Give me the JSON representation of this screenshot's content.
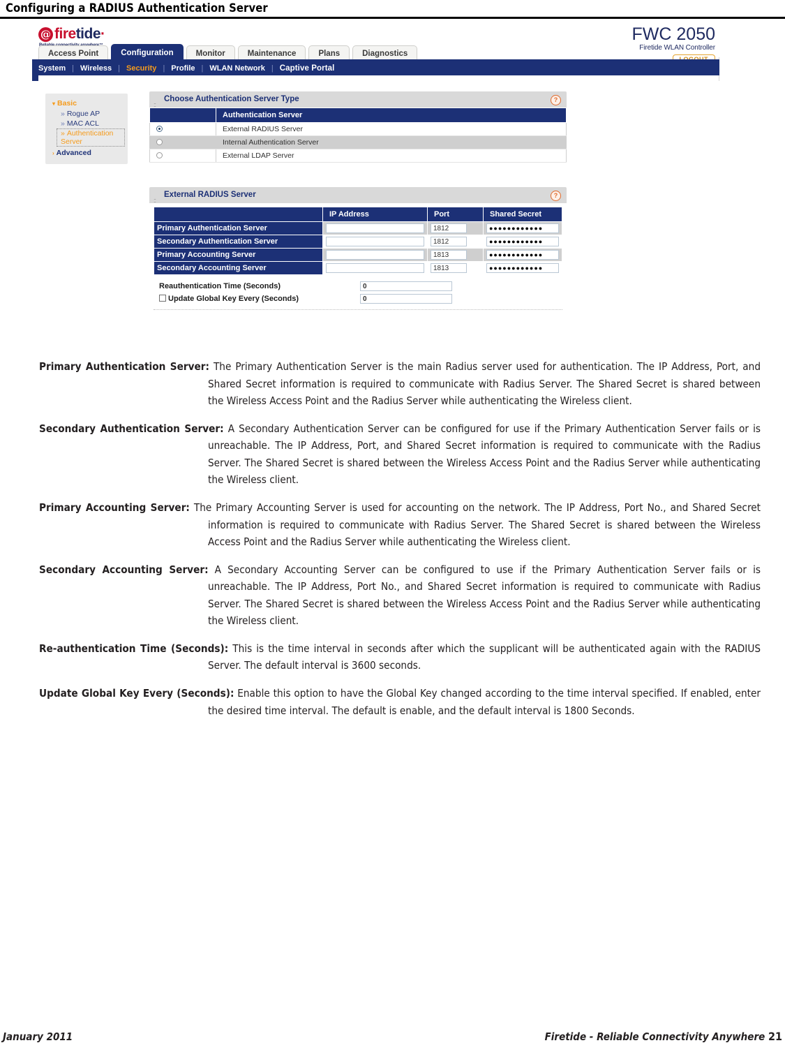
{
  "page": {
    "heading": "Configuring a RADIUS Authentication Server",
    "footer_left": "January 2011",
    "footer_right": "Firetide - Reliable Connectivity Anywhere",
    "page_number": "21"
  },
  "screenshot": {
    "brand": {
      "logo_mark": "flame-spiral-icon",
      "logo_fire": "fire",
      "logo_tide": "tide",
      "logo_dot": "·",
      "tagline": "Reliable connectivity anywhere™",
      "model_name": "FWC 2050",
      "model_sub": "Firetide WLAN Controller",
      "logout_label": "LOGOUT"
    },
    "tabs": [
      {
        "label": "Access Point",
        "active": false
      },
      {
        "label": "Configuration",
        "active": true
      },
      {
        "label": "Monitor",
        "active": false
      },
      {
        "label": "Maintenance",
        "active": false
      },
      {
        "label": "Plans",
        "active": false
      },
      {
        "label": "Diagnostics",
        "active": false
      }
    ],
    "subnav": [
      {
        "label": "System",
        "active": false
      },
      {
        "label": "Wireless",
        "active": false
      },
      {
        "label": "Security",
        "active": true
      },
      {
        "label": "Profile",
        "active": false
      },
      {
        "label": "WLAN Network",
        "active": false
      },
      {
        "label": "Captive Portal",
        "active": false
      }
    ],
    "sidebar": {
      "basic_label": "Basic",
      "basic_caret": "▾",
      "items": [
        {
          "label": "Rogue AP",
          "selected": false
        },
        {
          "label": "MAC ACL",
          "selected": false
        },
        {
          "label": "Authentication Server",
          "selected": true
        }
      ],
      "advanced_label": "Advanced",
      "advanced_caret": "›",
      "chevron": "»"
    },
    "panel_auth_type": {
      "title": "Choose Authentication Server Type",
      "help_icon_label": "?",
      "column_header": "Authentication Server",
      "options": [
        {
          "label": "External RADIUS Server",
          "selected": true
        },
        {
          "label": "Internal Authentication Server",
          "selected": false
        },
        {
          "label": "External LDAP Server",
          "selected": false
        }
      ]
    },
    "panel_radius": {
      "title": "External RADIUS Server",
      "help_icon_label": "?",
      "columns": [
        "",
        "IP Address",
        "Port",
        "Shared Secret"
      ],
      "rows": [
        {
          "label": "Primary Authentication Server",
          "ip": "",
          "port": "1812",
          "secret": "●●●●●●●●●●●●"
        },
        {
          "label": "Secondary Authentication Server",
          "ip": "",
          "port": "1812",
          "secret": "●●●●●●●●●●●●"
        },
        {
          "label": "Primary Accounting Server",
          "ip": "",
          "port": "1813",
          "secret": "●●●●●●●●●●●●"
        },
        {
          "label": "Secondary Accounting Server",
          "ip": "",
          "port": "1813",
          "secret": "●●●●●●●●●●●●"
        }
      ],
      "reauth_label": "Reauthentication Time (Seconds)",
      "reauth_value": "0",
      "globalkey_label": "Update Global Key Every (Seconds)",
      "globalkey_value": "0",
      "globalkey_checked": false
    }
  },
  "definitions": [
    {
      "term": "Primary Authentication Server:",
      "text": " The Primary Authentication Server is the main Radius server used for authentication. The IP Address, Port, and Shared Secret information is required to communicate with Radius Server. The Shared Secret is shared between the Wireless Access Point and the Radius Server while authenticating the Wireless client."
    },
    {
      "term": "Secondary Authentication Server:",
      "text": " A Secondary Authentication Server can be configured for use if the Primary Authentication Server fails or is unreachable. The IP Address, Port, and Shared Secret information is required to communicate with the Radius Server. The Shared Secret is shared between the Wireless Access Point and the Radius Server while authenticating the Wireless client."
    },
    {
      "term": "Primary Accounting Server:",
      "text": " The Primary Accounting Server is used for accounting on the network. The IP Address, Port No., and Shared Secret information is required to communicate with Radius Server. The Shared Secret is shared between the Wireless Access Point and the Radius Server while authenticating the Wireless client."
    },
    {
      "term": "Secondary Accounting Server:",
      "text": " A Secondary Accounting Server can be configured to use if the Primary Authentication Server fails or is unreachable. The IP Address, Port No., and Shared Secret information is required to communicate with Radius Server. The Shared Secret is shared between the Wireless Access Point and the Radius Server while authenticating the Wireless client."
    },
    {
      "term": "Re-authentication Time (Seconds):",
      "text": " This is the time interval in seconds after which the supplicant will be authenticated again with the RADIUS Server. The default interval is 3600 seconds."
    },
    {
      "term": "Update Global Key Every (Seconds):",
      "text": " Enable this option to have the Global Key changed according to the time interval specified. If enabled, enter the desired time interval. The default is enable, and the default interval is 1800 Seconds."
    }
  ],
  "colors": {
    "brand_blue": "#1c3076",
    "brand_red": "#c8102e",
    "accent_orange": "#f59b1c",
    "panel_gray": "#d9d9d9",
    "row_alt": "#cfcfcf"
  }
}
